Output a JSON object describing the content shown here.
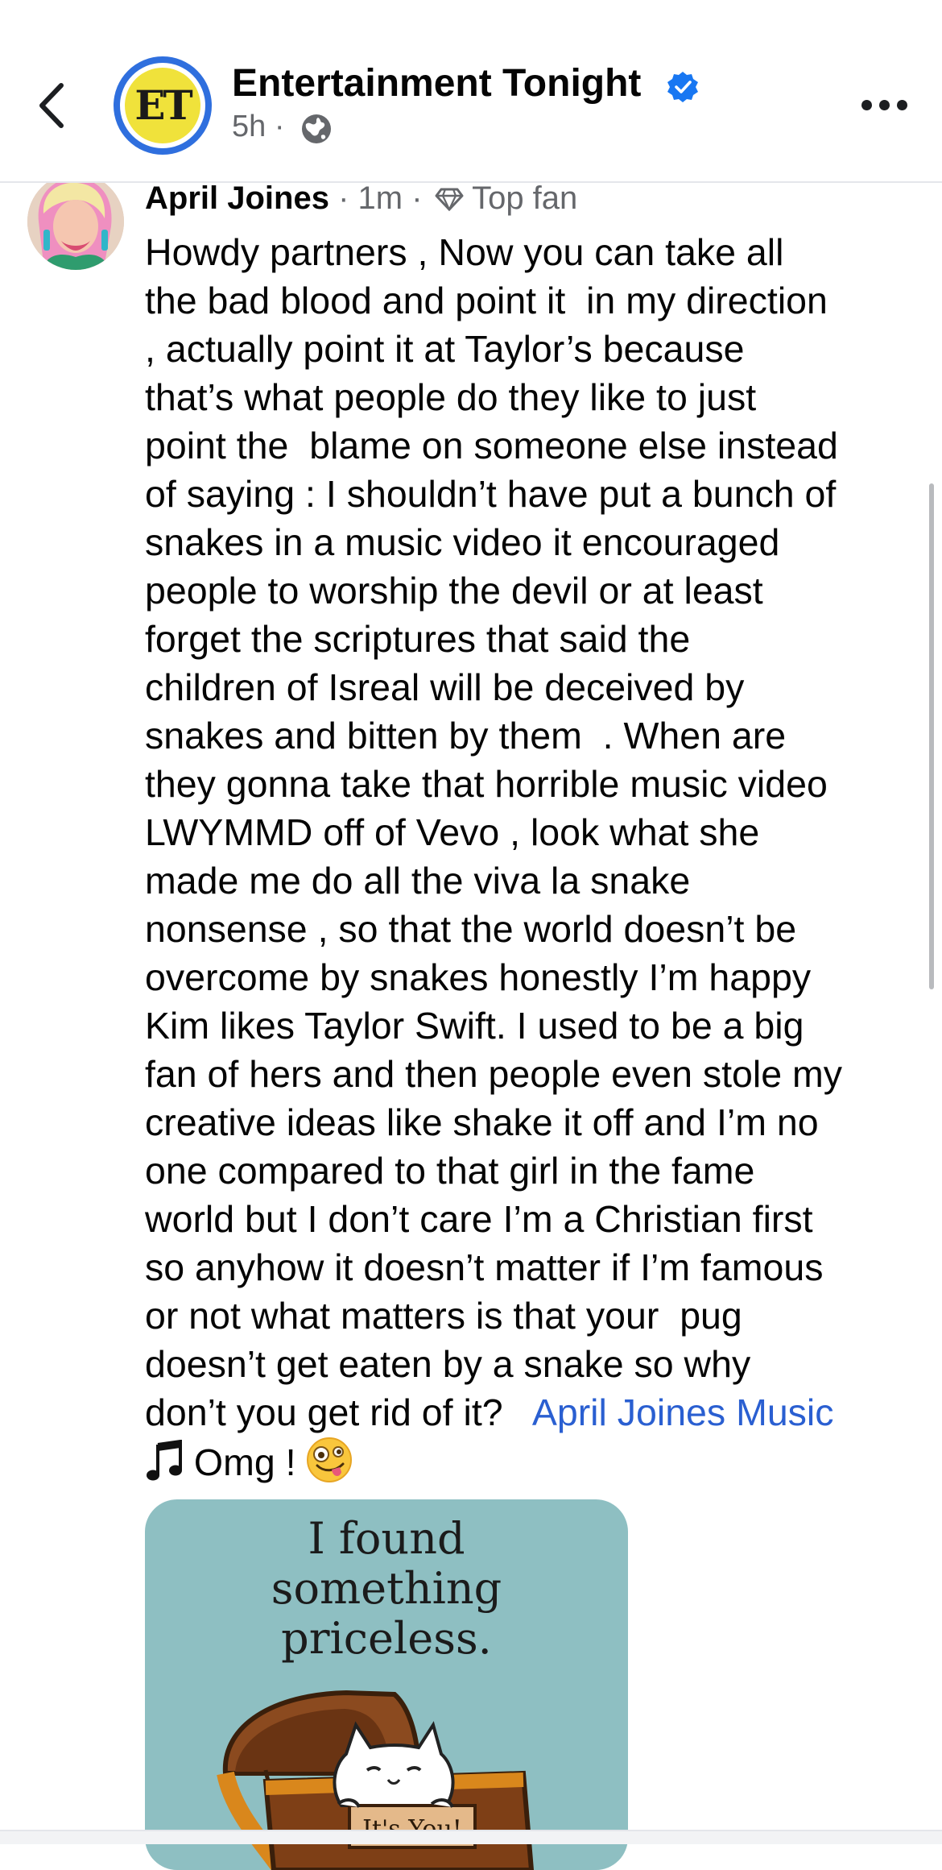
{
  "header": {
    "page_name": "Entertainment Tonight",
    "avatar_text": "ET",
    "post_time": "5h",
    "separator": "·",
    "back_icon": "chevron-left-icon",
    "more_icon": "more-horizontal-icon",
    "verified_icon": "verified-badge-icon",
    "privacy_icon": "globe-icon",
    "verified_color": "#1877f2"
  },
  "comment": {
    "author": "April Joines",
    "time": "1m",
    "separator": "·",
    "badge_label": "Top fan",
    "badge_icon": "diamond-icon",
    "lines": [
      "Howdy partners , Now you can take all",
      "the bad blood and point it  in my direction",
      ", actually point it at Taylor’s because",
      "that’s what people do they like to just",
      "point the  blame on someone else instead",
      "of saying : I shouldn’t have put a bunch of",
      "snakes in a music video it encouraged",
      "people to worship the devil or at least",
      "forget the scriptures that said the",
      "children of Isreal will be deceived by",
      "snakes and bitten by them  . When are",
      "they gonna take that horrible music video",
      "LWYMMD off of Vevo , look what she",
      "made me do all the viva la snake",
      "nonsense , so that the world doesn’t be",
      "overcome by snakes honestly I’m happy",
      "Kim likes Taylor Swift. I used to be a big",
      "fan of hers and then people even stole my",
      "creative ideas like shake it off and I’m no",
      "one compared to that girl in the fame",
      "world but I don’t care I’m a Christian first",
      "so anyhow it doesn’t matter if I’m famous",
      "or not what matters is that your  pug",
      "doesn’t get eaten by a snake so why"
    ],
    "last_line_text": "don’t you get rid of it?   ",
    "mention": "April Joines Music",
    "final_text": " Omg ! ",
    "note_icon": "music-note-icon",
    "emoji_icon": "zany-face-emoji",
    "link_color": "#2a5fd1"
  },
  "image": {
    "caption_lines": [
      "I found",
      "something",
      "priceless."
    ],
    "sign_text": "It's You!",
    "background_color": "#8ebfc2"
  }
}
